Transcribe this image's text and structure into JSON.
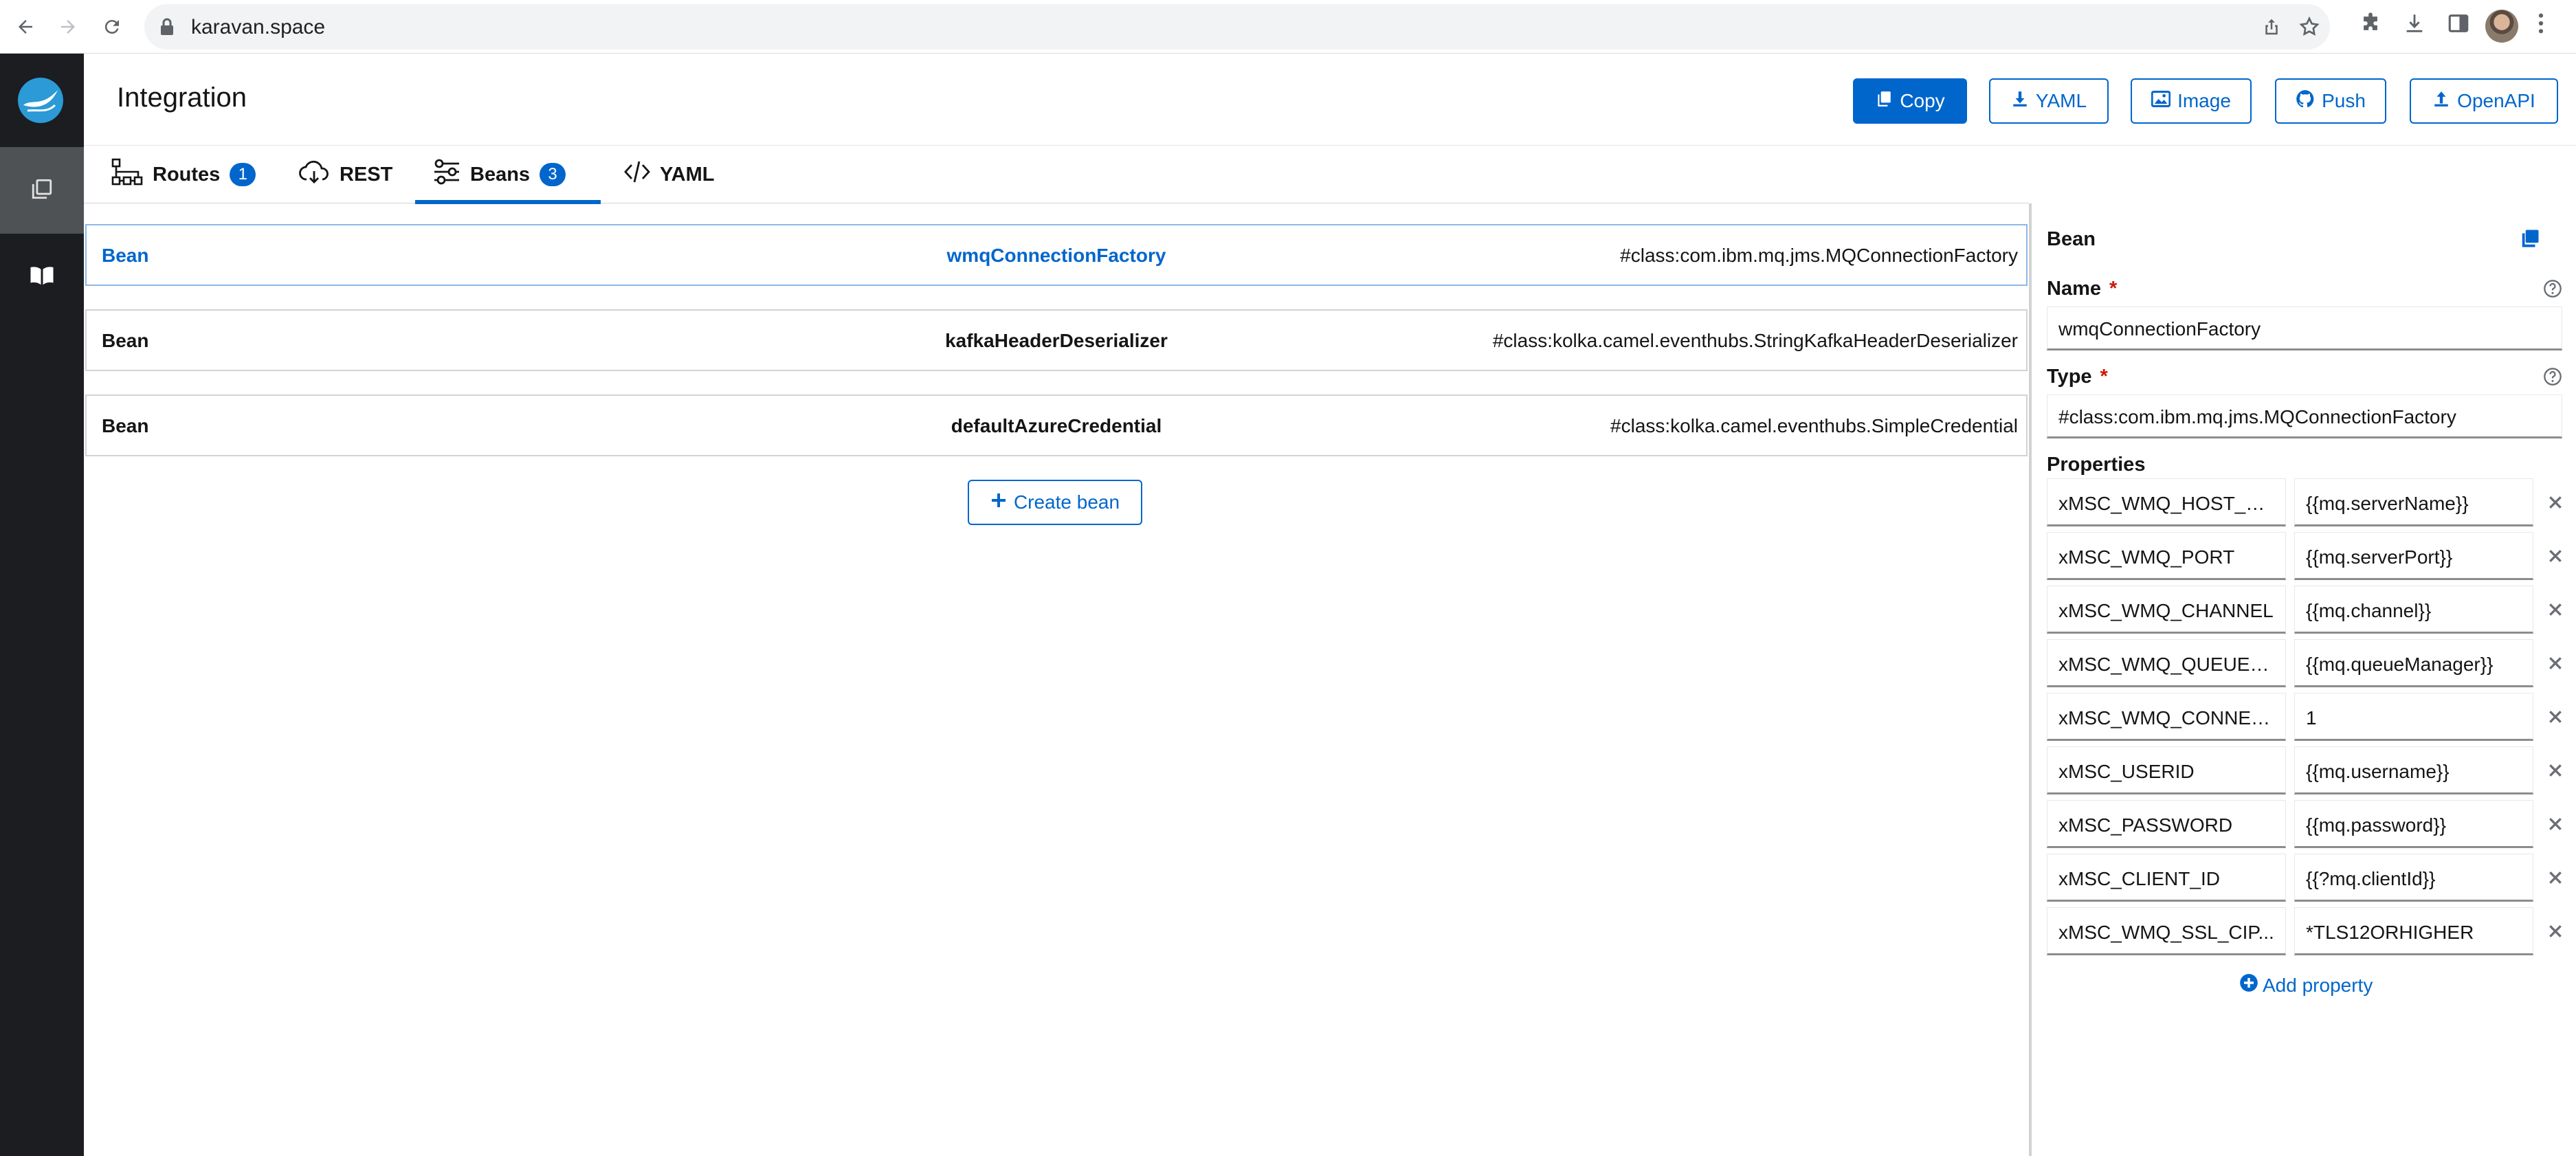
{
  "browser": {
    "url": "karavan.space",
    "icons": [
      "back-icon",
      "forward-icon",
      "reload-icon",
      "lock-icon",
      "share-icon",
      "bookmark-star-icon",
      "extensions-icon",
      "download-icon",
      "sidepanel-icon",
      "profile-avatar",
      "menu-kebab-icon"
    ]
  },
  "sidebar": {
    "items": [
      {
        "name": "integrations",
        "icon": "copy-stack-icon",
        "active": true
      },
      {
        "name": "documentation",
        "icon": "book-icon",
        "active": false
      }
    ]
  },
  "header": {
    "title": "Integration",
    "buttons": {
      "copy": "Copy",
      "yaml": "YAML",
      "image": "Image",
      "push": "Push",
      "openapi": "OpenAPI"
    }
  },
  "tabs": [
    {
      "label": "Routes",
      "count": "1",
      "icon": "routes-icon"
    },
    {
      "label": "REST",
      "icon": "cloud-icon"
    },
    {
      "label": "Beans",
      "count": "3",
      "icon": "sliders-icon",
      "active": true
    },
    {
      "label": "YAML",
      "icon": "code-icon"
    }
  ],
  "beans": [
    {
      "kind": "Bean",
      "name": "wmqConnectionFactory",
      "type": "#class:com.ibm.mq.jms.MQConnectionFactory",
      "selected": true
    },
    {
      "kind": "Bean",
      "name": "kafkaHeaderDeserializer",
      "type": "#class:kolka.camel.eventhubs.StringKafkaHeaderDeserializer"
    },
    {
      "kind": "Bean",
      "name": "defaultAzureCredential",
      "type": "#class:kolka.camel.eventhubs.SimpleCredential"
    }
  ],
  "create_bean_label": "Create bean",
  "panel": {
    "title": "Bean",
    "name_label": "Name",
    "name_value": "wmqConnectionFactory",
    "type_label": "Type",
    "type_value": "#class:com.ibm.mq.jms.MQConnectionFactory",
    "properties_label": "Properties",
    "properties": [
      {
        "key": "xMSC_WMQ_HOST_N...",
        "value": "{{mq.serverName}}"
      },
      {
        "key": "xMSC_WMQ_PORT",
        "value": "{{mq.serverPort}}"
      },
      {
        "key": "xMSC_WMQ_CHANNEL",
        "value": "{{mq.channel}}"
      },
      {
        "key": "xMSC_WMQ_QUEUE_...",
        "value": "{{mq.queueManager}}"
      },
      {
        "key": "xMSC_WMQ_CONNEC...",
        "value": "1"
      },
      {
        "key": "xMSC_USERID",
        "value": "{{mq.username}}"
      },
      {
        "key": "xMSC_PASSWORD",
        "value": "{{mq.password}}"
      },
      {
        "key": "xMSC_CLIENT_ID",
        "value": "{{?mq.clientId}}"
      },
      {
        "key": "xMSC_WMQ_SSL_CIP...",
        "value": "*TLS12ORHIGHER"
      }
    ],
    "add_property_label": "Add property"
  },
  "colors": {
    "accent": "#0066cc",
    "sidebar": "#1b1d21",
    "required": "#c9190b"
  }
}
